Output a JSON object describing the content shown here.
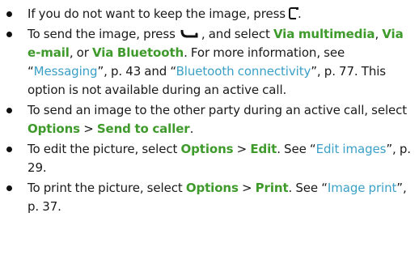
{
  "items": [
    {
      "t1": "If you do not want to keep the image, press",
      "t2": "."
    },
    {
      "t1": "To send the image, press",
      "t2": ", and select",
      "k1": "Via multimedia",
      "t3": ",",
      "k2": "Via e-mail",
      "t4": ", or",
      "k3": "Via Bluetooth",
      "t5": ". For more information, see “",
      "l1": "Messaging",
      "t6": "”, p. 43 and “",
      "l2": "Bluetooth connectivity",
      "t7": "”, p. 77. This option is not available during an active call."
    },
    {
      "t1": "To send an image to the other party during an active call, select",
      "k1": "Options",
      "t2": ">",
      "k2": "Send to caller",
      "t3": "."
    },
    {
      "t1": "To edit the picture, select",
      "k1": "Options",
      "t2": ">",
      "k2": "Edit",
      "t3": ". See “",
      "l1": "Edit images",
      "t4": "”, p. 29."
    },
    {
      "t1": "To print the picture, select",
      "k1": "Options",
      "t2": ">",
      "k2": "Print",
      "t3": ". See “",
      "l1": "Image print",
      "t4": "”, p. 37."
    }
  ],
  "icons": {
    "clear_key": "clear-key-icon",
    "send_key": "send-key-icon"
  },
  "colors": {
    "keyword": "#3f9a2c",
    "link": "#3aa0c6",
    "text": "#1a1a1a"
  }
}
